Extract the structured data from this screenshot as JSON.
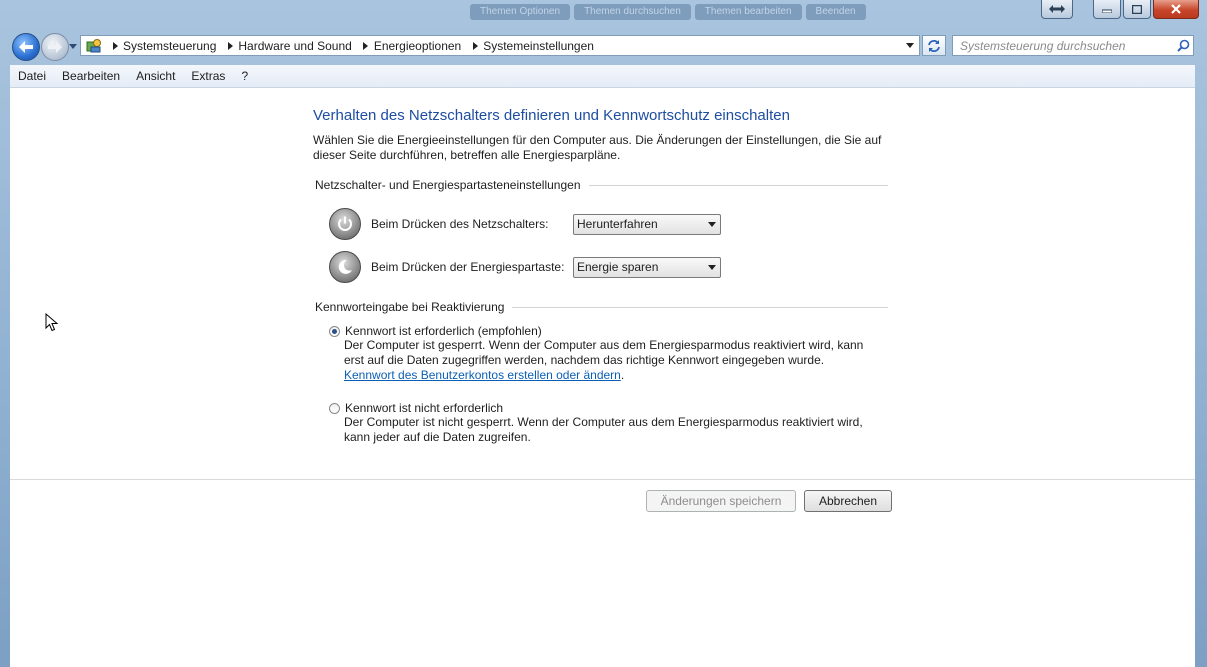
{
  "window": {
    "background_tabs": [
      "Themen Optionen",
      "Themen durchsuchen",
      "Themen bearbeiten",
      "Beenden"
    ]
  },
  "address_bar": {
    "breadcrumbs": [
      "Systemsteuerung",
      "Hardware und Sound",
      "Energieoptionen",
      "Systemeinstellungen"
    ]
  },
  "search": {
    "placeholder": "Systemsteuerung durchsuchen"
  },
  "menu": [
    "Datei",
    "Bearbeiten",
    "Ansicht",
    "Extras",
    "?"
  ],
  "page": {
    "title": "Verhalten des Netzschalters definieren und Kennwortschutz einschalten",
    "intro": "Wählen Sie die Energieeinstellungen für den Computer aus. Die Änderungen der Einstellungen, die Sie auf dieser Seite durchführen, betreffen alle Energiesparpläne."
  },
  "power_section": {
    "heading": "Netzschalter- und Energiespartasteneinstellungen",
    "power_button": {
      "label": "Beim Drücken des Netzschalters:",
      "value": "Herunterfahren"
    },
    "sleep_button": {
      "label": "Beim Drücken der Energiespartaste:",
      "value": "Energie sparen"
    }
  },
  "password_section": {
    "heading": "Kennworteingabe bei Reaktivierung",
    "option_required": {
      "label": "Kennwort ist erforderlich (empfohlen)",
      "selected": true,
      "description": "Der Computer ist gesperrt. Wenn der Computer aus dem Energiesparmodus reaktiviert wird, kann erst auf die Daten zugegriffen werden, nachdem das richtige Kennwort eingegeben wurde.",
      "link": "Kennwort des Benutzerkontos erstellen oder ändern",
      "link_suffix": "."
    },
    "option_not_required": {
      "label": "Kennwort ist nicht erforderlich",
      "selected": false,
      "description": "Der Computer ist nicht gesperrt. Wenn der Computer aus dem Energiesparmodus reaktiviert wird, kann jeder auf die Daten zugreifen."
    }
  },
  "buttons": {
    "save": "Änderungen speichern",
    "cancel": "Abbrechen"
  },
  "colors": {
    "title": "#1e4ea0",
    "link": "#0b5fb5",
    "close_button": "#c7462b"
  }
}
